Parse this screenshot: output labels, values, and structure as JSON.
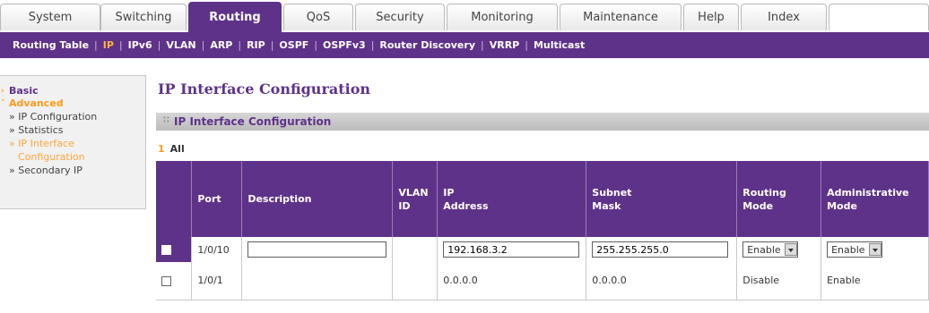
{
  "top_tabs": [
    {
      "label": "System"
    },
    {
      "label": "Switching"
    },
    {
      "label": "Routing"
    },
    {
      "label": "QoS"
    },
    {
      "label": "Security"
    },
    {
      "label": "Monitoring"
    },
    {
      "label": "Maintenance"
    },
    {
      "label": "Help"
    },
    {
      "label": "Index"
    }
  ],
  "active_top_tab": "Routing",
  "sub_nav": [
    {
      "label": "Routing Table"
    },
    {
      "label": "IP"
    },
    {
      "label": "IPv6"
    },
    {
      "label": "VLAN"
    },
    {
      "label": "ARP"
    },
    {
      "label": "RIP"
    },
    {
      "label": "OSPF"
    },
    {
      "label": "OSPFv3"
    },
    {
      "label": "Router Discovery"
    },
    {
      "label": "VRRP"
    },
    {
      "label": "Multicast"
    }
  ],
  "active_sub_nav": "IP",
  "sidebar": {
    "basic": "Basic",
    "advanced": "Advanced",
    "items": [
      {
        "label": "» IP Configuration"
      },
      {
        "label": "» Statistics"
      },
      {
        "label": "» IP Interface"
      },
      {
        "label": "Configuration"
      },
      {
        "label": "» Secondary IP"
      }
    ]
  },
  "page_title": "IP Interface Configuration",
  "panel_title": "IP Interface Configuration",
  "all_row": {
    "num": "1",
    "label": "All"
  },
  "columns": [
    "Port",
    "Description",
    "VLAN ID",
    "IP Address",
    "Subnet Mask",
    "Routing Mode",
    "Administrative Mode"
  ],
  "column_lines": {
    "vlan": [
      "VLAN",
      "ID"
    ],
    "ip": [
      "IP",
      "Address"
    ],
    "subnet": [
      "Subnet",
      "Mask"
    ],
    "routing": [
      "Routing",
      "Mode"
    ],
    "admin": [
      "Administrative",
      "Mode"
    ]
  },
  "edit_row": {
    "port": "1/0/10",
    "description": "",
    "ip_address": "192.168.3.2",
    "subnet_mask": "255.255.255.0",
    "routing_mode": "Enable",
    "admin_mode": "Enable"
  },
  "rows": [
    {
      "port": "1/0/1",
      "description": "",
      "vlan_id": "",
      "ip_address": "0.0.0.0",
      "subnet_mask": "0.0.0.0",
      "routing_mode": "Disable",
      "admin_mode": "Enable"
    }
  ],
  "colors": {
    "brand": "#5f3289",
    "accent": "#ff9a1a"
  }
}
